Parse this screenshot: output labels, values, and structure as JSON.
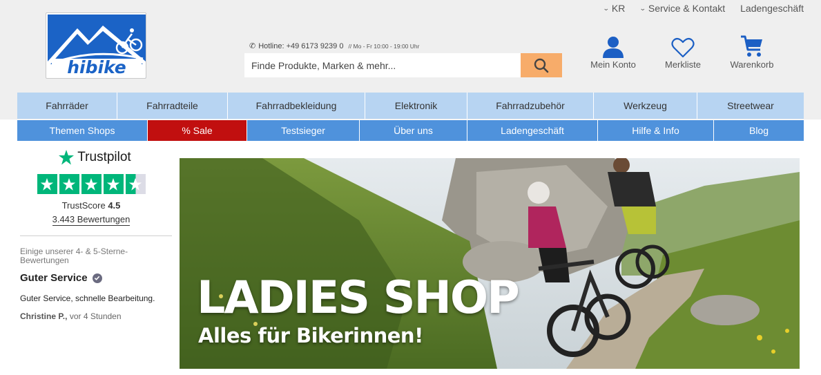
{
  "header": {
    "top_links": [
      {
        "label": "KR",
        "chevron": true
      },
      {
        "label": "Service & Kontakt",
        "chevron": true
      },
      {
        "label": "Ladengeschäft",
        "chevron": false
      }
    ],
    "logo_text": "hibike",
    "hotline_label": "Hotline: +49 6173 9239 0",
    "hotline_hours": "// Mo - Fr 10:00 - 19:00 Uhr",
    "search_placeholder": "Finde Produkte, Marken & mehr...",
    "search_value": "",
    "account_label": "Mein Konto",
    "wishlist_label": "Merkliste",
    "cart_label": "Warenkorb"
  },
  "nav_primary": [
    "Fahrräder",
    "Fahrradteile",
    "Fahrradbekleidung",
    "Elektronik",
    "Fahrradzubehör",
    "Werkzeug",
    "Streetwear"
  ],
  "nav_secondary": [
    "Themen Shops",
    "% Sale",
    "Testsieger",
    "Über uns",
    "Ladengeschäft",
    "Hilfe & Info",
    "Blog"
  ],
  "trustpilot": {
    "brand": "Trustpilot",
    "score_label": "TrustScore",
    "score": "4.5",
    "stars": 4.5,
    "reviews": "3.443 Bewertungen",
    "intro": "Einige unserer 4- & 5-Sterne-Bewertungen",
    "review_title": "Guter Service",
    "review_text": "Guter Service, schnelle Bearbeitung.",
    "review_author": "Christine P.,",
    "review_time": "vor 4 Stunden"
  },
  "banner": {
    "title": "LADIES SHOP",
    "subtitle": "Alles für Bikerinnen!"
  },
  "colors": {
    "header_bg": "#efefef",
    "nav_primary_bg": "#b7d4f2",
    "nav_secondary_bg": "#4f92dc",
    "sale_bg": "#c10f0f",
    "search_button": "#f7ac6a",
    "icon_blue": "#1c5fc4",
    "trustpilot_green": "#00b67a"
  }
}
